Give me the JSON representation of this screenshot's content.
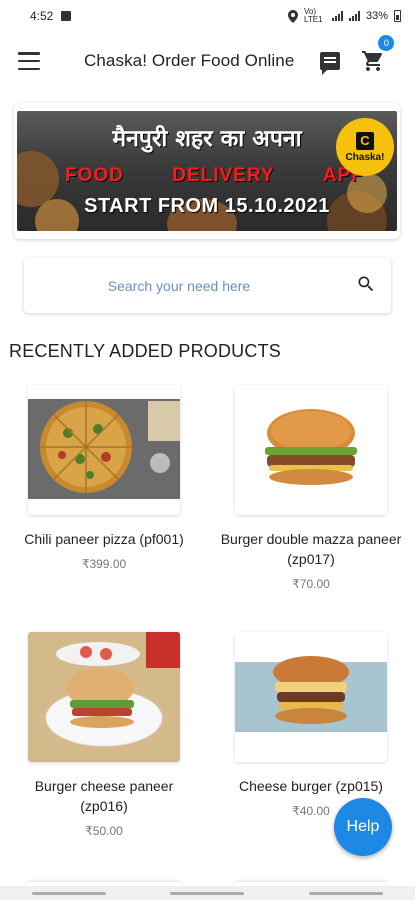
{
  "status_bar": {
    "time": "4:52",
    "network": "Vo) LTE1",
    "battery": "33%"
  },
  "app_bar": {
    "title": "Chaska! Order Food Online",
    "cart_count": "0"
  },
  "banner": {
    "hindi_text": "मैनपुरी शहर का अपना",
    "words": [
      "FOOD",
      "DELIVERY",
      "APP"
    ],
    "start_text": "START FROM 15.10.2021",
    "logo_letter": "C",
    "logo_text": "Chaska!"
  },
  "search": {
    "placeholder": "Search your need here"
  },
  "section": {
    "title": "RECENTLY ADDED PRODUCTS"
  },
  "products": [
    {
      "name": "Chili paneer pizza (pf001)",
      "price": "₹399.00",
      "image_icon": "pizza-image"
    },
    {
      "name": "Burger double mazza paneer (zp017)",
      "price": "₹70.00",
      "image_icon": "burger-image"
    },
    {
      "name": "Burger cheese paneer (zp016)",
      "price": "₹50.00",
      "image_icon": "burger-plate-image"
    },
    {
      "name": "Cheese burger (zp015)",
      "price": "₹40.00",
      "image_icon": "cheese-burger-image"
    }
  ],
  "help_button": {
    "label": "Help"
  },
  "colors": {
    "accent": "#1e88e5",
    "banner_red": "#ff1a1a",
    "logo_yellow": "#f4c20d"
  }
}
